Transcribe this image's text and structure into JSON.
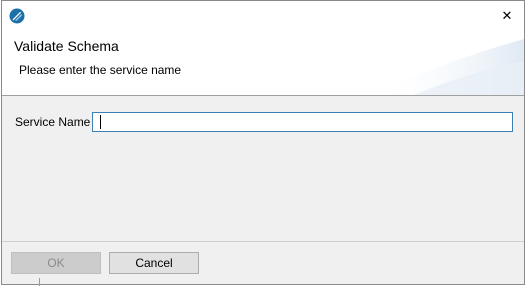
{
  "window": {
    "app_icon": "app-logo-icon",
    "close_icon": "close-icon",
    "close_glyph": "✕"
  },
  "banner": {
    "title": "Validate Schema",
    "subtitle": "Please enter the service name"
  },
  "form": {
    "service_name_label": "Service Name",
    "service_name_value": ""
  },
  "buttons": {
    "ok_label": "OK",
    "ok_enabled": false,
    "cancel_label": "Cancel"
  },
  "colors": {
    "accent": "#3c7fb1",
    "dialog_bg": "#f0f0f0",
    "banner_bg": "#ffffff"
  }
}
